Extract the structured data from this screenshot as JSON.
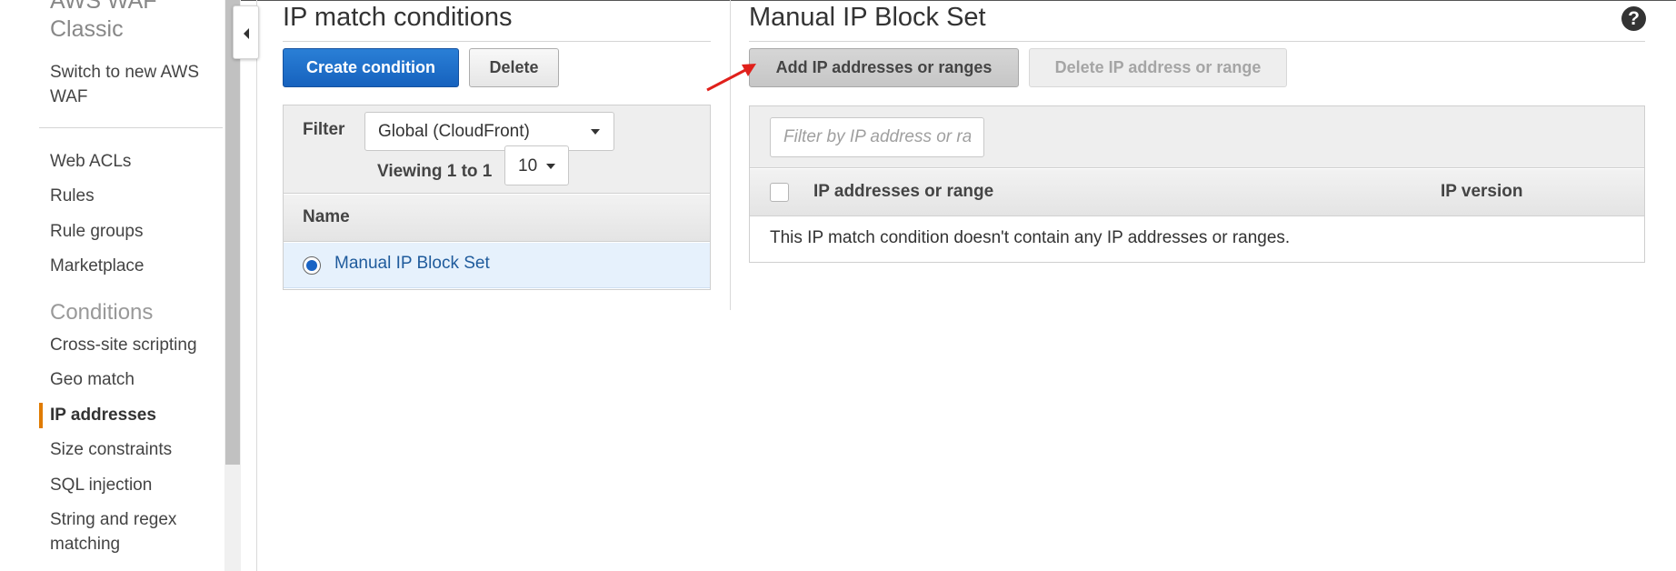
{
  "sidebar": {
    "title": "AWS WAF Classic",
    "switch_link": "Switch to new AWS WAF",
    "nav_items": [
      {
        "label": "Web ACLs"
      },
      {
        "label": "Rules"
      },
      {
        "label": "Rule groups"
      },
      {
        "label": "Marketplace"
      }
    ],
    "section_title": "Conditions",
    "condition_items": [
      {
        "label": "Cross-site scripting"
      },
      {
        "label": "Geo match"
      },
      {
        "label": "IP addresses",
        "active": true
      },
      {
        "label": "Size constraints"
      },
      {
        "label": "SQL injection"
      },
      {
        "label": "String and regex matching"
      }
    ],
    "active_color": "#e07b00"
  },
  "conditions_panel": {
    "title": "IP match conditions",
    "create_button": "Create condition",
    "delete_button": "Delete",
    "filter_label": "Filter",
    "filter_value": "Global (CloudFront)",
    "viewing_text": "Viewing 1 to 1",
    "page_size": "10",
    "column_name": "Name",
    "rows": [
      {
        "name": "Manual IP Block Set",
        "selected": true
      }
    ]
  },
  "detail_panel": {
    "title": "Manual IP Block Set",
    "add_button": "Add IP addresses or ranges",
    "delete_button": "Delete IP address or range",
    "filter_placeholder": "Filter by IP address or range",
    "col_ip": "IP addresses or range",
    "col_version": "IP version",
    "empty_message": "This IP match condition doesn't contain any IP addresses or ranges."
  },
  "colors": {
    "primary_button": "#1a6dcc",
    "link": "#1f5b9c",
    "annotation_arrow": "#e0201b"
  },
  "icons": {
    "collapse": "caret-left-icon",
    "help": "question-circle-icon",
    "dropdown": "caret-down-icon"
  }
}
